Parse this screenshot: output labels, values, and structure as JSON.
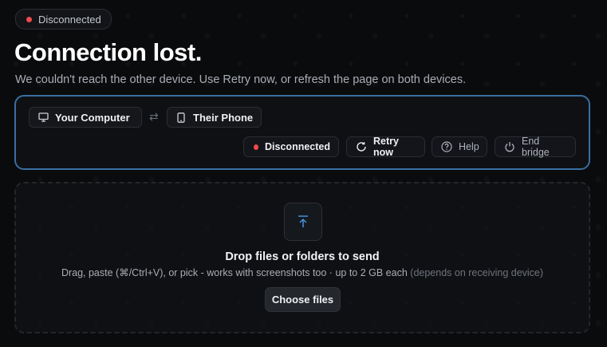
{
  "status_badge": {
    "label": "Disconnected",
    "color": "#f04a4a"
  },
  "header": {
    "title": "Connection lost.",
    "subtitle": "We couldn't reach the other device. Use Retry now, or refresh the page on both devices."
  },
  "bridge": {
    "local_device": {
      "label": "Your Computer",
      "icon": "monitor-icon"
    },
    "swap_icon": "swap-arrows-icon",
    "remote_device": {
      "label": "Their Phone",
      "icon": "phone-icon"
    },
    "status": {
      "label": "Disconnected",
      "color": "#f04a4a"
    },
    "retry_label": "Retry now",
    "help_label": "Help",
    "end_label": "End bridge",
    "accent_border": "#3a6ea1"
  },
  "dropzone": {
    "icon": "upload-arrow-icon",
    "title": "Drop files or folders to send",
    "subtitle": "Drag, paste (⌘/Ctrl+V), or pick - works with screenshots too · up to 2 GB each",
    "subtitle_muted": "(depends on receiving device)",
    "choose_label": "Choose files",
    "icon_color": "#4a90d9"
  }
}
